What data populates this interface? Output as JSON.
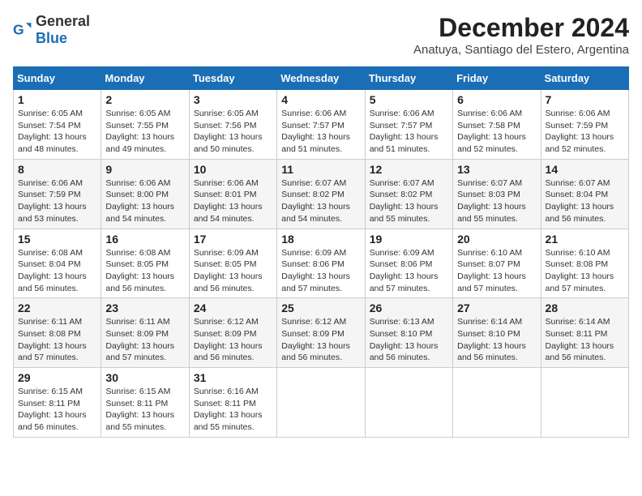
{
  "header": {
    "logo_general": "General",
    "logo_blue": "Blue",
    "title": "December 2024",
    "subtitle": "Anatuya, Santiago del Estero, Argentina"
  },
  "calendar": {
    "days_of_week": [
      "Sunday",
      "Monday",
      "Tuesday",
      "Wednesday",
      "Thursday",
      "Friday",
      "Saturday"
    ],
    "weeks": [
      [
        {
          "day": "",
          "info": ""
        },
        {
          "day": "2",
          "info": "Sunrise: 6:05 AM\nSunset: 7:55 PM\nDaylight: 13 hours\nand 49 minutes."
        },
        {
          "day": "3",
          "info": "Sunrise: 6:05 AM\nSunset: 7:56 PM\nDaylight: 13 hours\nand 50 minutes."
        },
        {
          "day": "4",
          "info": "Sunrise: 6:06 AM\nSunset: 7:57 PM\nDaylight: 13 hours\nand 51 minutes."
        },
        {
          "day": "5",
          "info": "Sunrise: 6:06 AM\nSunset: 7:57 PM\nDaylight: 13 hours\nand 51 minutes."
        },
        {
          "day": "6",
          "info": "Sunrise: 6:06 AM\nSunset: 7:58 PM\nDaylight: 13 hours\nand 52 minutes."
        },
        {
          "day": "7",
          "info": "Sunrise: 6:06 AM\nSunset: 7:59 PM\nDaylight: 13 hours\nand 52 minutes."
        }
      ],
      [
        {
          "day": "1",
          "info": "Sunrise: 6:05 AM\nSunset: 7:54 PM\nDaylight: 13 hours\nand 48 minutes."
        },
        {
          "day": "9",
          "info": "Sunrise: 6:06 AM\nSunset: 8:00 PM\nDaylight: 13 hours\nand 54 minutes."
        },
        {
          "day": "10",
          "info": "Sunrise: 6:06 AM\nSunset: 8:01 PM\nDaylight: 13 hours\nand 54 minutes."
        },
        {
          "day": "11",
          "info": "Sunrise: 6:07 AM\nSunset: 8:02 PM\nDaylight: 13 hours\nand 54 minutes."
        },
        {
          "day": "12",
          "info": "Sunrise: 6:07 AM\nSunset: 8:02 PM\nDaylight: 13 hours\nand 55 minutes."
        },
        {
          "day": "13",
          "info": "Sunrise: 6:07 AM\nSunset: 8:03 PM\nDaylight: 13 hours\nand 55 minutes."
        },
        {
          "day": "14",
          "info": "Sunrise: 6:07 AM\nSunset: 8:04 PM\nDaylight: 13 hours\nand 56 minutes."
        }
      ],
      [
        {
          "day": "8",
          "info": "Sunrise: 6:06 AM\nSunset: 7:59 PM\nDaylight: 13 hours\nand 53 minutes."
        },
        {
          "day": "16",
          "info": "Sunrise: 6:08 AM\nSunset: 8:05 PM\nDaylight: 13 hours\nand 56 minutes."
        },
        {
          "day": "17",
          "info": "Sunrise: 6:09 AM\nSunset: 8:05 PM\nDaylight: 13 hours\nand 56 minutes."
        },
        {
          "day": "18",
          "info": "Sunrise: 6:09 AM\nSunset: 8:06 PM\nDaylight: 13 hours\nand 57 minutes."
        },
        {
          "day": "19",
          "info": "Sunrise: 6:09 AM\nSunset: 8:06 PM\nDaylight: 13 hours\nand 57 minutes."
        },
        {
          "day": "20",
          "info": "Sunrise: 6:10 AM\nSunset: 8:07 PM\nDaylight: 13 hours\nand 57 minutes."
        },
        {
          "day": "21",
          "info": "Sunrise: 6:10 AM\nSunset: 8:08 PM\nDaylight: 13 hours\nand 57 minutes."
        }
      ],
      [
        {
          "day": "15",
          "info": "Sunrise: 6:08 AM\nSunset: 8:04 PM\nDaylight: 13 hours\nand 56 minutes."
        },
        {
          "day": "23",
          "info": "Sunrise: 6:11 AM\nSunset: 8:09 PM\nDaylight: 13 hours\nand 57 minutes."
        },
        {
          "day": "24",
          "info": "Sunrise: 6:12 AM\nSunset: 8:09 PM\nDaylight: 13 hours\nand 56 minutes."
        },
        {
          "day": "25",
          "info": "Sunrise: 6:12 AM\nSunset: 8:09 PM\nDaylight: 13 hours\nand 56 minutes."
        },
        {
          "day": "26",
          "info": "Sunrise: 6:13 AM\nSunset: 8:10 PM\nDaylight: 13 hours\nand 56 minutes."
        },
        {
          "day": "27",
          "info": "Sunrise: 6:14 AM\nSunset: 8:10 PM\nDaylight: 13 hours\nand 56 minutes."
        },
        {
          "day": "28",
          "info": "Sunrise: 6:14 AM\nSunset: 8:11 PM\nDaylight: 13 hours\nand 56 minutes."
        }
      ],
      [
        {
          "day": "22",
          "info": "Sunrise: 6:11 AM\nSunset: 8:08 PM\nDaylight: 13 hours\nand 57 minutes."
        },
        {
          "day": "30",
          "info": "Sunrise: 6:15 AM\nSunset: 8:11 PM\nDaylight: 13 hours\nand 55 minutes."
        },
        {
          "day": "31",
          "info": "Sunrise: 6:16 AM\nSunset: 8:11 PM\nDaylight: 13 hours\nand 55 minutes."
        },
        {
          "day": "",
          "info": ""
        },
        {
          "day": "",
          "info": ""
        },
        {
          "day": "",
          "info": ""
        },
        {
          "day": "",
          "info": ""
        }
      ],
      [
        {
          "day": "29",
          "info": "Sunrise: 6:15 AM\nSunset: 8:11 PM\nDaylight: 13 hours\nand 56 minutes."
        },
        {
          "day": "",
          "info": ""
        },
        {
          "day": "",
          "info": ""
        },
        {
          "day": "",
          "info": ""
        },
        {
          "day": "",
          "info": ""
        },
        {
          "day": "",
          "info": ""
        },
        {
          "day": "",
          "info": ""
        }
      ]
    ]
  }
}
